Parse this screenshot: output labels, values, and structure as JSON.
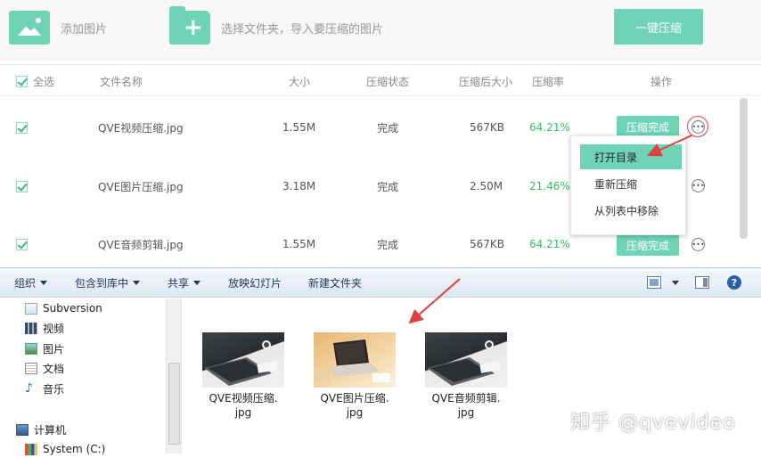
{
  "toolbar": {
    "add_image_label": "添加图片",
    "select_folder_label": "选择文件夹，导入要压缩的图片",
    "compress_all_label": "一键压缩"
  },
  "table": {
    "headers": {
      "select_all": "全选",
      "name": "文件名称",
      "size": "大小",
      "status": "压缩状态",
      "compressed_size": "压缩后大小",
      "ratio": "压缩率",
      "action": "操作"
    },
    "rows": [
      {
        "name": "QVE视频压缩.jpg",
        "size": "1.55M",
        "status": "完成",
        "compressed_size": "567KB",
        "ratio": "64.21%",
        "button": "压缩完成",
        "checked": true
      },
      {
        "name": "QVE图片压缩.jpg",
        "size": "3.18M",
        "status": "完成",
        "compressed_size": "2.50M",
        "ratio": "21.46%",
        "button": "",
        "checked": true
      },
      {
        "name": "QVE音频剪辑.jpg",
        "size": "1.55M",
        "status": "完成",
        "compressed_size": "567KB",
        "ratio": "64.21%",
        "button": "压缩完成",
        "checked": true
      }
    ]
  },
  "context_menu": {
    "items": [
      "打开目录",
      "重新压缩",
      "从列表中移除"
    ]
  },
  "explorer": {
    "toolbar": {
      "organize": "组织",
      "include_library": "包含到库中",
      "share": "共享",
      "slideshow": "放映幻灯片",
      "new_folder": "新建文件夹"
    },
    "nav_items": [
      "Subversion",
      "视频",
      "图片",
      "文档",
      "音乐",
      "计算机",
      "System (C:)"
    ],
    "files": [
      {
        "line1": "QVE视频压缩.",
        "line2": "jpg"
      },
      {
        "line1": "QVE图片压缩.",
        "line2": "jpg"
      },
      {
        "line1": "QVE音频剪辑.",
        "line2": "jpg"
      }
    ]
  },
  "watermark": "知乎 @qvevideo",
  "colors": {
    "accent": "#6ed4b5",
    "ratio_green": "#3ac060",
    "arrow_red": "#e04040"
  }
}
